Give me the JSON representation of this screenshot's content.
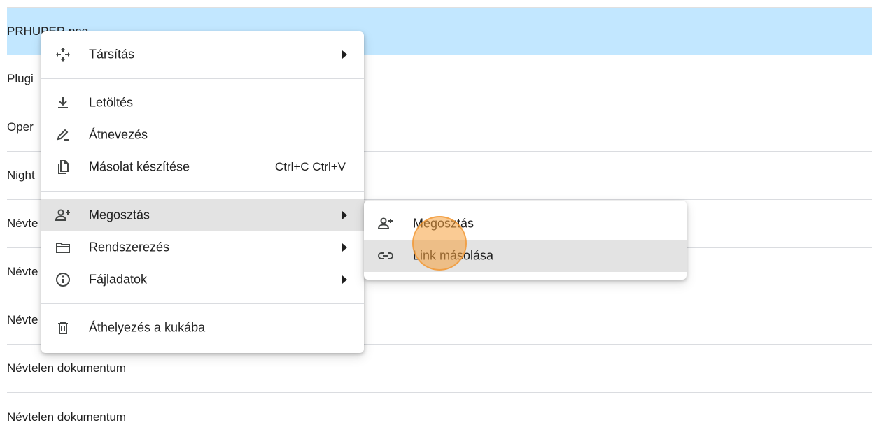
{
  "files": [
    {
      "name": "PRHUPER.png",
      "selected": true
    },
    {
      "name": "Plugi"
    },
    {
      "name": "Oper"
    },
    {
      "name": "Night"
    },
    {
      "name": "Névte"
    },
    {
      "name": "Névte"
    },
    {
      "name": "Névte"
    },
    {
      "name": "Névtelen dokumentum"
    },
    {
      "name": "Névtelen dokumentum"
    }
  ],
  "context_menu": {
    "items": [
      {
        "label": "Társítás",
        "icon": "move-arrows-icon"
      },
      {
        "label": "Letöltés",
        "icon": "download-icon"
      },
      {
        "label": "Átnevezés",
        "icon": "rename-pen-icon"
      },
      {
        "label": "Másolat készítése",
        "icon": "copy-icon",
        "shortcut": "Ctrl+C Ctrl+V"
      },
      {
        "label": "Megosztás",
        "icon": "person-add-icon"
      },
      {
        "label": "Rendszerezés",
        "icon": "folder-open-icon"
      },
      {
        "label": "Fájladatok",
        "icon": "info-icon"
      },
      {
        "label": "Áthelyezés a kukába",
        "icon": "trash-icon"
      }
    ]
  },
  "share_submenu": {
    "items": [
      {
        "label": "Megosztás",
        "icon": "person-add-icon"
      },
      {
        "label": "Link másolása",
        "icon": "link-icon"
      }
    ]
  },
  "colors": {
    "selected_row": "#c2e7ff",
    "hover_item": "#e3e3e3",
    "click_indicator": "#f5a03c"
  }
}
